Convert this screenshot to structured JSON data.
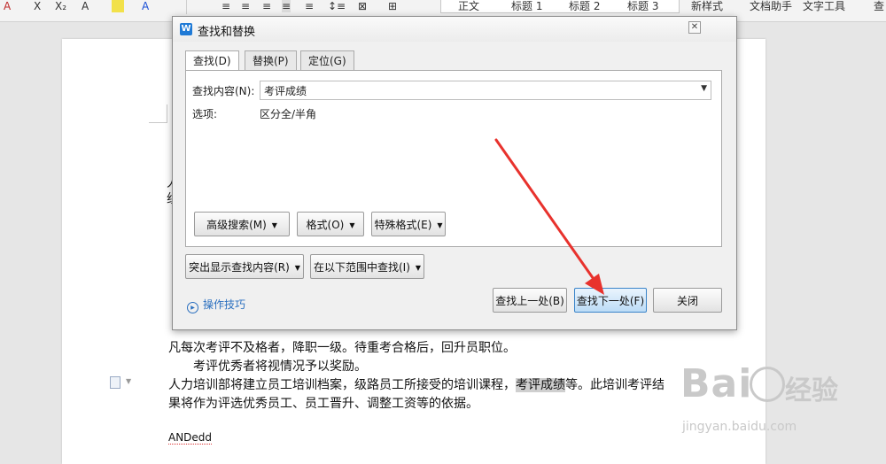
{
  "toolbar": {
    "format_glyphs": [
      "A",
      "X",
      "X₂",
      "A",
      "A"
    ],
    "styles": [
      "正文",
      "标题 1",
      "标题 2",
      "标题 3"
    ],
    "new_style": "新样式",
    "doc_helper": "文档助手",
    "text_tools": "文字工具",
    "search": "查"
  },
  "document": {
    "lines": [
      "凡每次考评不及格者，降职一级。待重考合格后，回升员职位。",
      "考评优秀者将视情况予以奖励。",
      "人力培训部将建立员工培训档案，级路员工所接受的培训课程，",
      "考评成绩",
      "等。此培训考评结",
      "果将作为评选优秀员工、员工晋升、调整工资等的依据。",
      "ANDedd"
    ]
  },
  "dialog": {
    "title": "查找和替换",
    "app_icon": "W",
    "tabs": [
      "查找(D)",
      "替换(P)",
      "定位(G)"
    ],
    "find_label": "查找内容(N):",
    "find_value": "考评成绩",
    "options_label": "选项:",
    "options_value": "区分全/半角",
    "advanced_search": "高级搜索(M)",
    "format": "格式(O)",
    "special_format": "特殊格式(E)",
    "highlight_found": "突出显示查找内容(R)",
    "find_in": "在以下范围中查找(I)",
    "tips": "操作技巧",
    "find_prev": "查找上一处(B)",
    "find_next": "查找下一处(F)",
    "close": "关闭"
  },
  "watermark": {
    "brand": "Bai",
    "brand_tail": "经验",
    "url": "jingyan.baidu.com"
  },
  "colors": {
    "annotation_arrow": "#e8322d",
    "primary_button": "#bcdcf6",
    "link": "#2a6fbf"
  }
}
